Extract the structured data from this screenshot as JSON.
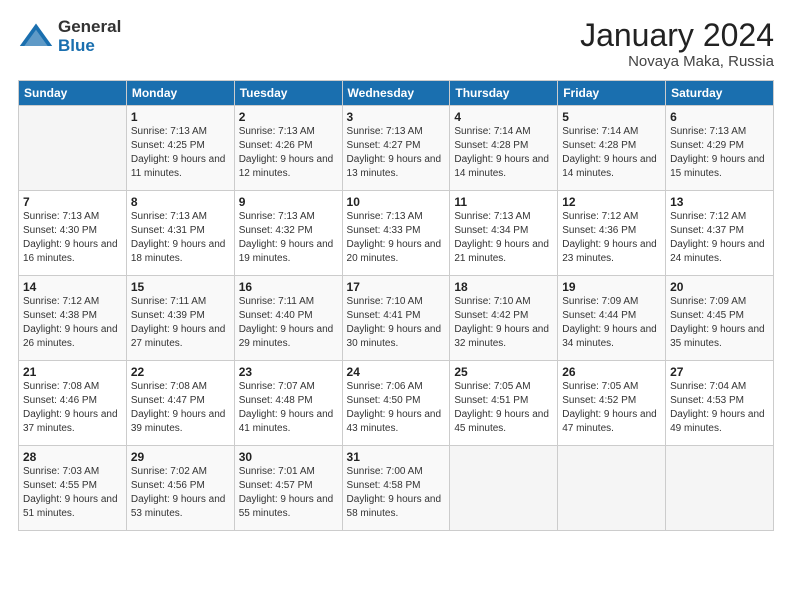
{
  "logo": {
    "general": "General",
    "blue": "Blue"
  },
  "title": "January 2024",
  "subtitle": "Novaya Maka, Russia",
  "days_header": [
    "Sunday",
    "Monday",
    "Tuesday",
    "Wednesday",
    "Thursday",
    "Friday",
    "Saturday"
  ],
  "weeks": [
    [
      {
        "num": "",
        "sunrise": "",
        "sunset": "",
        "daylight": ""
      },
      {
        "num": "1",
        "sunrise": "7:13 AM",
        "sunset": "4:25 PM",
        "daylight": "9 hours and 11 minutes."
      },
      {
        "num": "2",
        "sunrise": "7:13 AM",
        "sunset": "4:26 PM",
        "daylight": "9 hours and 12 minutes."
      },
      {
        "num": "3",
        "sunrise": "7:13 AM",
        "sunset": "4:27 PM",
        "daylight": "9 hours and 13 minutes."
      },
      {
        "num": "4",
        "sunrise": "7:14 AM",
        "sunset": "4:28 PM",
        "daylight": "9 hours and 14 minutes."
      },
      {
        "num": "5",
        "sunrise": "7:14 AM",
        "sunset": "4:28 PM",
        "daylight": "9 hours and 14 minutes."
      },
      {
        "num": "6",
        "sunrise": "7:13 AM",
        "sunset": "4:29 PM",
        "daylight": "9 hours and 15 minutes."
      }
    ],
    [
      {
        "num": "7",
        "sunrise": "7:13 AM",
        "sunset": "4:30 PM",
        "daylight": "9 hours and 16 minutes."
      },
      {
        "num": "8",
        "sunrise": "7:13 AM",
        "sunset": "4:31 PM",
        "daylight": "9 hours and 18 minutes."
      },
      {
        "num": "9",
        "sunrise": "7:13 AM",
        "sunset": "4:32 PM",
        "daylight": "9 hours and 19 minutes."
      },
      {
        "num": "10",
        "sunrise": "7:13 AM",
        "sunset": "4:33 PM",
        "daylight": "9 hours and 20 minutes."
      },
      {
        "num": "11",
        "sunrise": "7:13 AM",
        "sunset": "4:34 PM",
        "daylight": "9 hours and 21 minutes."
      },
      {
        "num": "12",
        "sunrise": "7:12 AM",
        "sunset": "4:36 PM",
        "daylight": "9 hours and 23 minutes."
      },
      {
        "num": "13",
        "sunrise": "7:12 AM",
        "sunset": "4:37 PM",
        "daylight": "9 hours and 24 minutes."
      }
    ],
    [
      {
        "num": "14",
        "sunrise": "7:12 AM",
        "sunset": "4:38 PM",
        "daylight": "9 hours and 26 minutes."
      },
      {
        "num": "15",
        "sunrise": "7:11 AM",
        "sunset": "4:39 PM",
        "daylight": "9 hours and 27 minutes."
      },
      {
        "num": "16",
        "sunrise": "7:11 AM",
        "sunset": "4:40 PM",
        "daylight": "9 hours and 29 minutes."
      },
      {
        "num": "17",
        "sunrise": "7:10 AM",
        "sunset": "4:41 PM",
        "daylight": "9 hours and 30 minutes."
      },
      {
        "num": "18",
        "sunrise": "7:10 AM",
        "sunset": "4:42 PM",
        "daylight": "9 hours and 32 minutes."
      },
      {
        "num": "19",
        "sunrise": "7:09 AM",
        "sunset": "4:44 PM",
        "daylight": "9 hours and 34 minutes."
      },
      {
        "num": "20",
        "sunrise": "7:09 AM",
        "sunset": "4:45 PM",
        "daylight": "9 hours and 35 minutes."
      }
    ],
    [
      {
        "num": "21",
        "sunrise": "7:08 AM",
        "sunset": "4:46 PM",
        "daylight": "9 hours and 37 minutes."
      },
      {
        "num": "22",
        "sunrise": "7:08 AM",
        "sunset": "4:47 PM",
        "daylight": "9 hours and 39 minutes."
      },
      {
        "num": "23",
        "sunrise": "7:07 AM",
        "sunset": "4:48 PM",
        "daylight": "9 hours and 41 minutes."
      },
      {
        "num": "24",
        "sunrise": "7:06 AM",
        "sunset": "4:50 PM",
        "daylight": "9 hours and 43 minutes."
      },
      {
        "num": "25",
        "sunrise": "7:05 AM",
        "sunset": "4:51 PM",
        "daylight": "9 hours and 45 minutes."
      },
      {
        "num": "26",
        "sunrise": "7:05 AM",
        "sunset": "4:52 PM",
        "daylight": "9 hours and 47 minutes."
      },
      {
        "num": "27",
        "sunrise": "7:04 AM",
        "sunset": "4:53 PM",
        "daylight": "9 hours and 49 minutes."
      }
    ],
    [
      {
        "num": "28",
        "sunrise": "7:03 AM",
        "sunset": "4:55 PM",
        "daylight": "9 hours and 51 minutes."
      },
      {
        "num": "29",
        "sunrise": "7:02 AM",
        "sunset": "4:56 PM",
        "daylight": "9 hours and 53 minutes."
      },
      {
        "num": "30",
        "sunrise": "7:01 AM",
        "sunset": "4:57 PM",
        "daylight": "9 hours and 55 minutes."
      },
      {
        "num": "31",
        "sunrise": "7:00 AM",
        "sunset": "4:58 PM",
        "daylight": "9 hours and 58 minutes."
      },
      {
        "num": "",
        "sunrise": "",
        "sunset": "",
        "daylight": ""
      },
      {
        "num": "",
        "sunrise": "",
        "sunset": "",
        "daylight": ""
      },
      {
        "num": "",
        "sunrise": "",
        "sunset": "",
        "daylight": ""
      }
    ]
  ]
}
